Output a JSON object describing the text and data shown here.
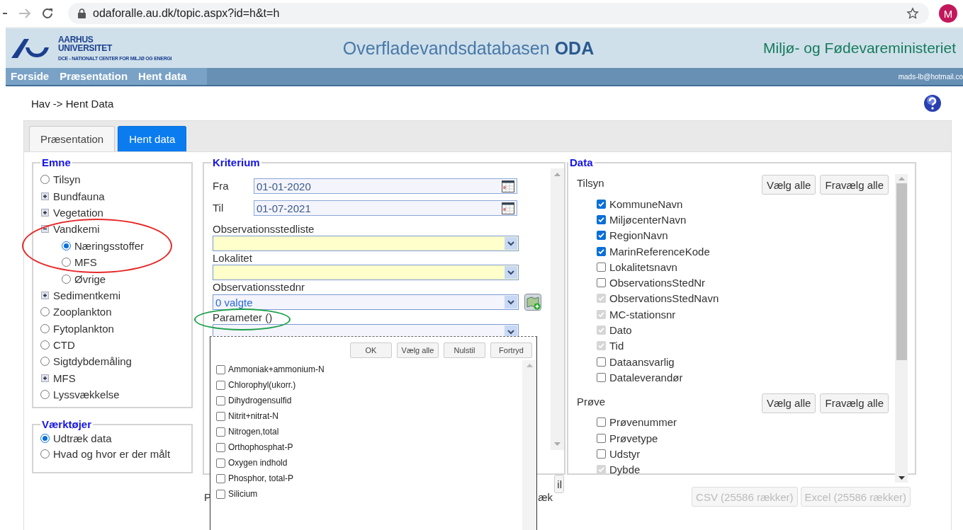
{
  "browser": {
    "url": "odaforalle.au.dk/topic.aspx?id=h&t=h",
    "avatar": "M"
  },
  "header": {
    "logo_lines": [
      "AARHUS",
      "UNIVERSITET"
    ],
    "logo_subtitle": "DCE - NATIONALT CENTER FOR MILJØ OG ENERGI",
    "title": "Overfladevandsdatabasen **ODA**",
    "ministry": "Miljø- og Fødevareministeriet"
  },
  "nav": {
    "items": [
      {
        "label": "Forside"
      },
      {
        "label": "Præsentation"
      },
      {
        "label": "Hent data"
      }
    ],
    "user": "mads-lb@hotmail.co"
  },
  "breadcrumb": "Hav -> Hent Data",
  "tabs": [
    {
      "label": "Præsentation",
      "selected": false
    },
    {
      "label": "Hent data",
      "selected": true
    }
  ],
  "emne": {
    "legend": "Emne",
    "items": [
      {
        "kind": "radio",
        "label": "Tilsyn",
        "selected": false
      },
      {
        "kind": "group",
        "label": "Bundfauna",
        "expanded": false
      },
      {
        "kind": "group",
        "label": "Vegetation",
        "expanded": false
      },
      {
        "kind": "group",
        "label": "Vandkemi",
        "expanded": true,
        "highlight": {
          "color": "#e8282a"
        },
        "children": [
          {
            "kind": "radio",
            "label": "Næringsstoffer",
            "selected": true
          },
          {
            "kind": "radio",
            "label": "MFS",
            "selected": false
          },
          {
            "kind": "radio",
            "label": "Øvrige",
            "selected": false
          }
        ]
      },
      {
        "kind": "group",
        "label": "Sedimentkemi",
        "expanded": false
      },
      {
        "kind": "radio",
        "label": "Zooplankton",
        "selected": false
      },
      {
        "kind": "radio",
        "label": "Fytoplankton",
        "selected": false
      },
      {
        "kind": "radio",
        "label": "CTD",
        "selected": false
      },
      {
        "kind": "radio",
        "label": "Sigtdybdemåling",
        "selected": false
      },
      {
        "kind": "group",
        "label": "MFS",
        "expanded": false
      },
      {
        "kind": "radio",
        "label": "Lyssvækkelse",
        "selected": false
      }
    ]
  },
  "vaerktojer": {
    "legend": "Værktøjer",
    "options": [
      {
        "label": "Udtræk data",
        "selected": true
      },
      {
        "label": "Hvad og hvor er der målt",
        "selected": false
      }
    ]
  },
  "kriterium": {
    "legend": "Kriterium",
    "dates": [
      {
        "label": "Fra",
        "value": "01-01-2020"
      },
      {
        "label": "Til",
        "value": "01-07-2021"
      }
    ],
    "selects": [
      {
        "label": "Observationsstedliste",
        "kind": "yellow"
      },
      {
        "label": "Lokalitet",
        "kind": "yellow"
      },
      {
        "label": "Observationsstednr",
        "kind": "plain",
        "value": "0 valgte",
        "map_button": true
      },
      {
        "label": "Parameter ()",
        "kind": "plain",
        "highlight": {
          "color": "#1aa04a"
        }
      }
    ],
    "covered_button": "il",
    "footer_left": "P",
    "footer_right": "æk"
  },
  "parameter_popup": {
    "buttons": [
      "OK",
      "Vælg alle",
      "Nulstil",
      "Fortryd"
    ],
    "options": [
      {
        "label": "Ammoniak+ammonium-N",
        "checked": false
      },
      {
        "label": "Chlorophyl(ukorr.)",
        "checked": false
      },
      {
        "label": "Dihydrogensulfid",
        "checked": false
      },
      {
        "label": "Nitrit+nitrat-N",
        "checked": false
      },
      {
        "label": "Nitrogen,total",
        "checked": false
      },
      {
        "label": "Orthophosphat-P",
        "checked": false
      },
      {
        "label": "Oxygen indhold",
        "checked": false
      },
      {
        "label": "Phosphor, total-P",
        "checked": false
      },
      {
        "label": "Silicium",
        "checked": false
      }
    ]
  },
  "data": {
    "legend": "Data",
    "sections": [
      {
        "title": "Tilsyn",
        "buttons": [
          "Vælg alle",
          "Fravælg alle"
        ],
        "fields": [
          {
            "label": "KommuneNavn",
            "checked": true,
            "disabled": false
          },
          {
            "label": "MiljøcenterNavn",
            "checked": true,
            "disabled": false
          },
          {
            "label": "RegionNavn",
            "checked": true,
            "disabled": false
          },
          {
            "label": "MarinReferenceKode",
            "checked": true,
            "disabled": false
          },
          {
            "label": "Lokalitetsnavn",
            "checked": false,
            "disabled": false
          },
          {
            "label": "ObservationsStedNr",
            "checked": false,
            "disabled": false
          },
          {
            "label": "ObservationsStedNavn",
            "checked": true,
            "disabled": true
          },
          {
            "label": "MC-stationsnr",
            "checked": true,
            "disabled": true
          },
          {
            "label": "Dato",
            "checked": true,
            "disabled": true
          },
          {
            "label": "Tid",
            "checked": true,
            "disabled": true
          },
          {
            "label": "Dataansvarlig",
            "checked": false,
            "disabled": false
          },
          {
            "label": "Dataleverandør",
            "checked": false,
            "disabled": false
          }
        ]
      },
      {
        "title": "Prøve",
        "buttons": [
          "Vælg alle",
          "Fravælg alle"
        ],
        "fields": [
          {
            "label": "Prøvenummer",
            "checked": false,
            "disabled": false
          },
          {
            "label": "Prøvetype",
            "checked": false,
            "disabled": false
          },
          {
            "label": "Udstyr",
            "checked": false,
            "disabled": false
          },
          {
            "label": "Dybde",
            "checked": true,
            "disabled": true
          }
        ]
      }
    ]
  },
  "export_buttons": [
    {
      "label": "CSV (25586 rækker)",
      "disabled": true
    },
    {
      "label": "Excel (25586 rækker)",
      "disabled": true
    }
  ]
}
